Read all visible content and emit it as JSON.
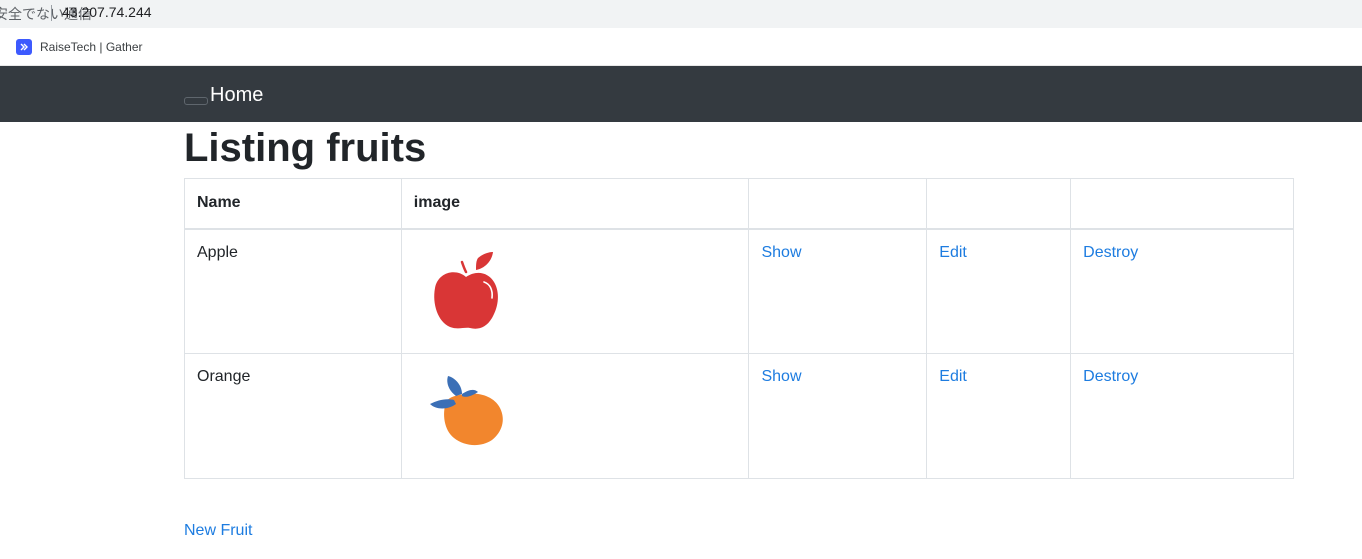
{
  "browser": {
    "security_label": "安全でない通信",
    "url": "43.207.74.244",
    "bookmark_label": "RaiseTech | Gather"
  },
  "navbar": {
    "brand": "Home"
  },
  "page": {
    "title": "Listing fruits",
    "new_link": "New Fruit"
  },
  "table": {
    "headers": [
      "Name",
      "image",
      "",
      "",
      ""
    ],
    "rows": [
      {
        "name": "Apple",
        "image_icon": "apple-icon",
        "show": "Show",
        "edit": "Edit",
        "destroy": "Destroy"
      },
      {
        "name": "Orange",
        "image_icon": "orange-icon",
        "show": "Show",
        "edit": "Edit",
        "destroy": "Destroy"
      }
    ]
  },
  "colors": {
    "navbar_bg": "#343a40",
    "link": "#1d7ce0",
    "apple": "#d93636",
    "orange": "#f2862d",
    "leaf": "#3b6fb6"
  }
}
